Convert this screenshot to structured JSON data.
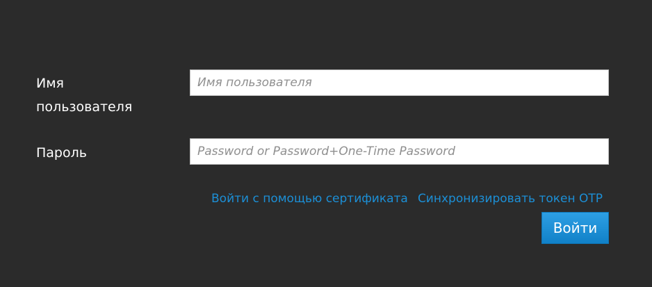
{
  "login_form": {
    "username": {
      "label_line1": "Имя",
      "label_line2": "пользователя",
      "placeholder": "Имя пользователя",
      "value": ""
    },
    "password": {
      "label": "Пароль",
      "placeholder": "Password or Password+One-Time Password",
      "value": ""
    },
    "links": {
      "certificate_login": "Войти с помощью сертификата",
      "sync_otp": "Синхронизировать токен OTP"
    },
    "submit_label": "Войти"
  },
  "colors": {
    "background": "#2b2b2b",
    "label_text": "#ffffff",
    "link": "#1c8fd6",
    "button": "#1a8fd8"
  }
}
